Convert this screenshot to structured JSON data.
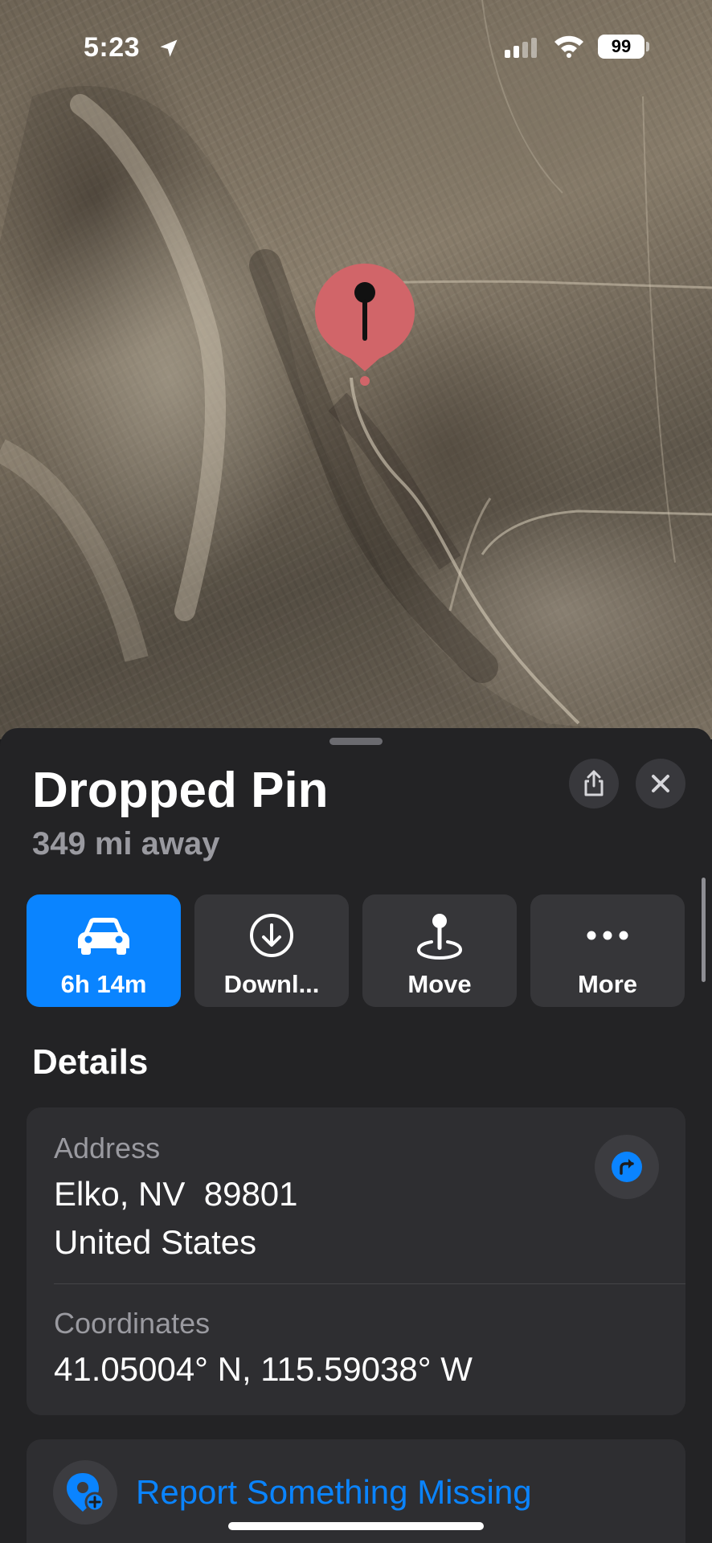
{
  "status_bar": {
    "time": "5:23",
    "battery": "99",
    "icons": [
      "location-arrow-icon",
      "cellular-signal-icon",
      "wifi-icon",
      "battery-icon"
    ]
  },
  "map": {
    "type": "satellite",
    "pin_color": "#d16569"
  },
  "place": {
    "title": "Dropped Pin",
    "distance": "349 mi away"
  },
  "actions": [
    {
      "label": "6h 14m",
      "icon": "car-icon",
      "primary": true
    },
    {
      "label": "Downl...",
      "icon": "download-icon",
      "primary": false
    },
    {
      "label": "Move",
      "icon": "move-pin-icon",
      "primary": false
    },
    {
      "label": "More",
      "icon": "ellipsis-icon",
      "primary": false
    }
  ],
  "details": {
    "heading": "Details",
    "address_label": "Address",
    "address_line1": "Elko, NV  89801",
    "address_line2": "United States",
    "coordinates_label": "Coordinates",
    "coordinates_value": "41.05004° N, 115.59038° W"
  },
  "report": {
    "label": "Report Something Missing"
  },
  "colors": {
    "accent": "#0a84ff",
    "sheet_bg": "#232325",
    "card_bg": "#2e2e31",
    "secondary_text": "#9a9aa0"
  }
}
